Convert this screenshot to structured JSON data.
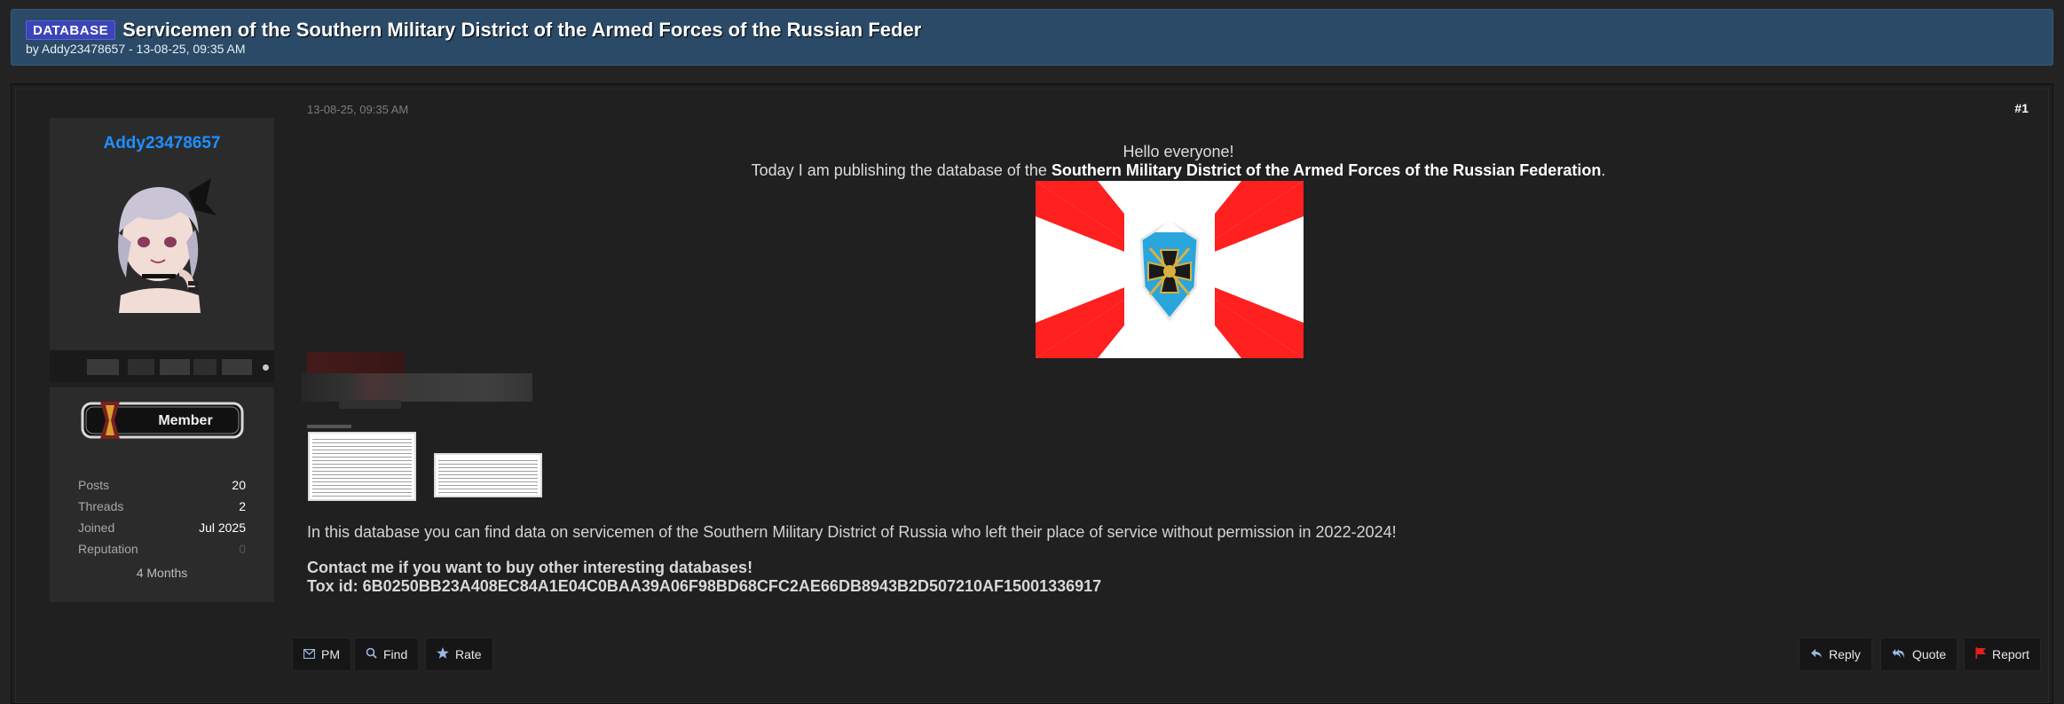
{
  "thread": {
    "prefix": "DATABASE",
    "title": "Servicemen of the Southern Military District of the Armed Forces of the Russian Feder",
    "byline": "by Addy23478657 - 13-08-25, 09:35 AM"
  },
  "user": {
    "name": "Addy23478657",
    "rank": "Member",
    "stats": [
      {
        "label": "Posts",
        "value": "20"
      },
      {
        "label": "Threads",
        "value": "2"
      },
      {
        "label": "Joined",
        "value": "Jul 2025"
      },
      {
        "label": "Reputation",
        "value": "0"
      }
    ],
    "membership": "4 Months"
  },
  "post": {
    "date": "13-08-25, 09:35 AM",
    "number": "#1",
    "greeting": "Hello everyone!",
    "intro_prefix": "Today I am publishing the database of the ",
    "intro_bold": "Southern Military District of the Armed Forces of the Russian Federation",
    "intro_suffix": ".",
    "description": "In this database you can find data on servicemen of the Southern Military District of Russia who left their place of service without permission in 2022-2024!",
    "contact": "Contact me if you want to buy other interesting databases!",
    "tox": "Tox id: 6B0250BB23A408EC84A1E04C0BAA39A06F98BD68CFC2AE66DB8943B2D507210AF15001336917"
  },
  "actions_left": [
    {
      "label": "PM",
      "icon": "mail-icon"
    },
    {
      "label": "Find",
      "icon": "search-icon"
    },
    {
      "label": "Rate",
      "icon": "star-icon"
    }
  ],
  "actions_right": [
    {
      "label": "Reply",
      "icon": "reply-icon"
    },
    {
      "label": "Quote",
      "icon": "quote-icon"
    },
    {
      "label": "Report",
      "icon": "flag-icon"
    }
  ],
  "colors": {
    "header_bg": "#2a4a68",
    "prefix_bg": "#3b44b8",
    "username": "#1e90ff",
    "report_flag": "#e02020"
  }
}
